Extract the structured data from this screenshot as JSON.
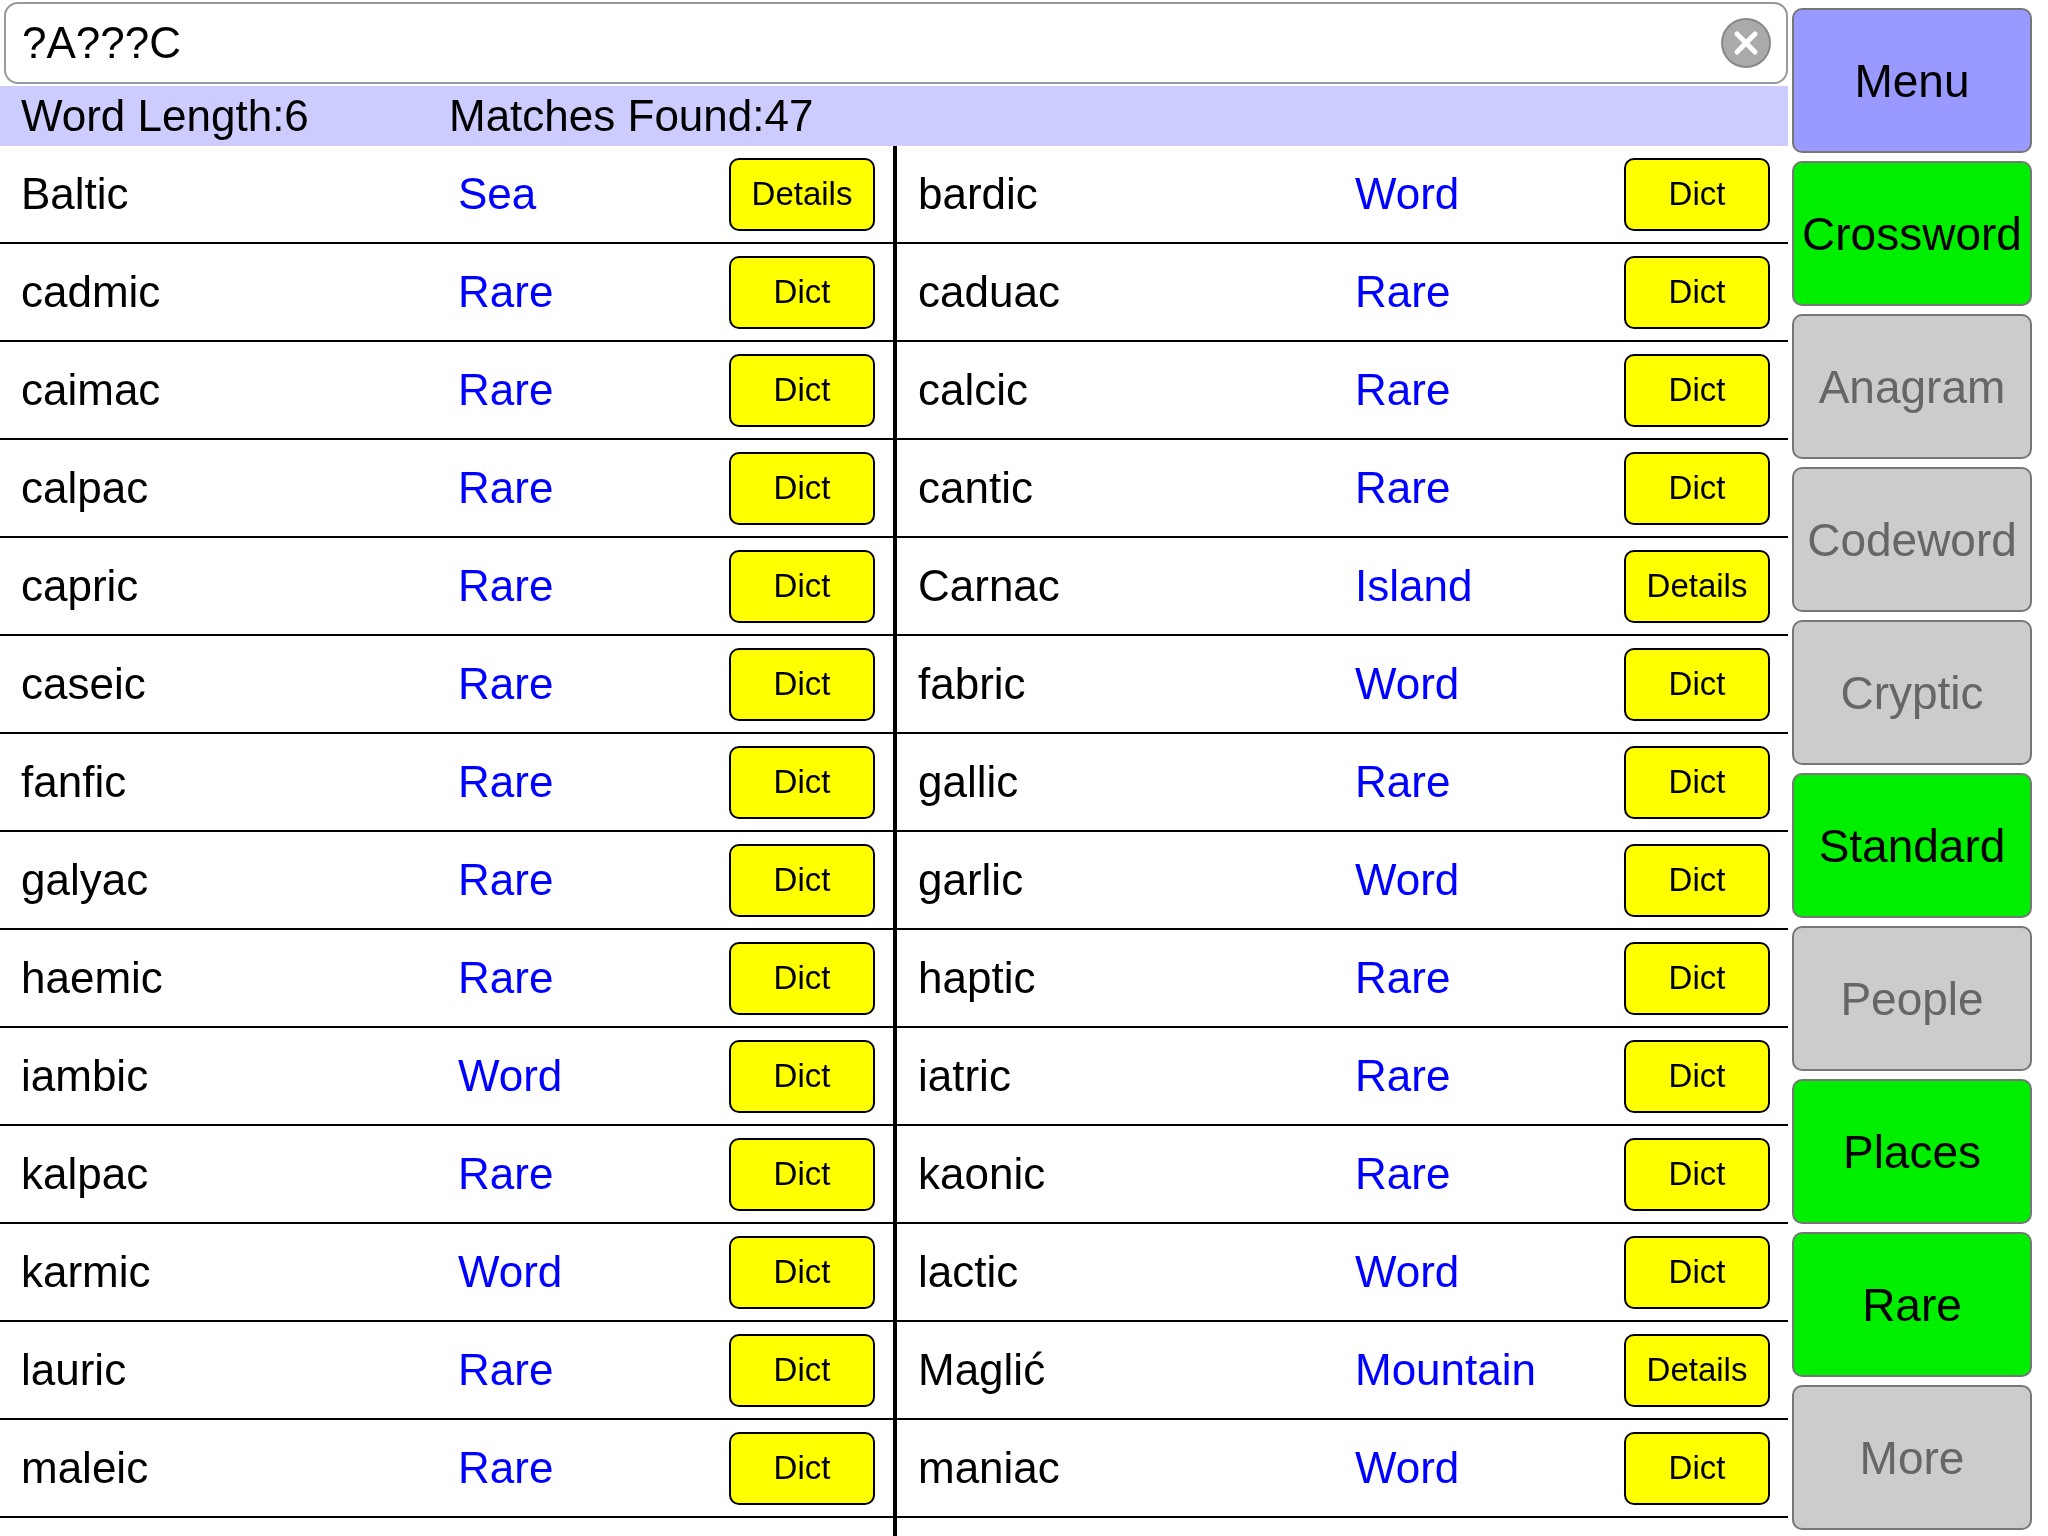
{
  "search": {
    "value": "?A???C"
  },
  "info": {
    "word_length": "Word Length:6",
    "matches": "Matches Found:47"
  },
  "rows": [
    {
      "left": {
        "word": "Baltic",
        "category": "Sea",
        "action": "Details"
      },
      "right": {
        "word": "bardic",
        "category": "Word",
        "action": "Dict"
      }
    },
    {
      "left": {
        "word": "cadmic",
        "category": "Rare",
        "action": "Dict"
      },
      "right": {
        "word": "caduac",
        "category": "Rare",
        "action": "Dict"
      }
    },
    {
      "left": {
        "word": "caimac",
        "category": "Rare",
        "action": "Dict"
      },
      "right": {
        "word": "calcic",
        "category": "Rare",
        "action": "Dict"
      }
    },
    {
      "left": {
        "word": "calpac",
        "category": "Rare",
        "action": "Dict"
      },
      "right": {
        "word": "cantic",
        "category": "Rare",
        "action": "Dict"
      }
    },
    {
      "left": {
        "word": "capric",
        "category": "Rare",
        "action": "Dict"
      },
      "right": {
        "word": "Carnac",
        "category": "Island",
        "action": "Details"
      }
    },
    {
      "left": {
        "word": "caseic",
        "category": "Rare",
        "action": "Dict"
      },
      "right": {
        "word": "fabric",
        "category": "Word",
        "action": "Dict"
      }
    },
    {
      "left": {
        "word": "fanfic",
        "category": "Rare",
        "action": "Dict"
      },
      "right": {
        "word": "gallic",
        "category": "Rare",
        "action": "Dict"
      }
    },
    {
      "left": {
        "word": "galyac",
        "category": "Rare",
        "action": "Dict"
      },
      "right": {
        "word": "garlic",
        "category": "Word",
        "action": "Dict"
      }
    },
    {
      "left": {
        "word": "haemic",
        "category": "Rare",
        "action": "Dict"
      },
      "right": {
        "word": "haptic",
        "category": "Rare",
        "action": "Dict"
      }
    },
    {
      "left": {
        "word": "iambic",
        "category": "Word",
        "action": "Dict"
      },
      "right": {
        "word": "iatric",
        "category": "Rare",
        "action": "Dict"
      }
    },
    {
      "left": {
        "word": "kalpac",
        "category": "Rare",
        "action": "Dict"
      },
      "right": {
        "word": "kaonic",
        "category": "Rare",
        "action": "Dict"
      }
    },
    {
      "left": {
        "word": "karmic",
        "category": "Word",
        "action": "Dict"
      },
      "right": {
        "word": "lactic",
        "category": "Word",
        "action": "Dict"
      }
    },
    {
      "left": {
        "word": "lauric",
        "category": "Rare",
        "action": "Dict"
      },
      "right": {
        "word": "Maglić",
        "category": "Mountain",
        "action": "Details"
      }
    },
    {
      "left": {
        "word": "maleic",
        "category": "Rare",
        "action": "Dict"
      },
      "right": {
        "word": "maniac",
        "category": "Word",
        "action": "Dict"
      }
    }
  ],
  "sidebar": [
    {
      "label": "Menu",
      "kind": "menu"
    },
    {
      "label": "Crossword",
      "kind": "toggle",
      "on": true
    },
    {
      "label": "Anagram",
      "kind": "toggle",
      "on": false
    },
    {
      "label": "Codeword",
      "kind": "toggle",
      "on": false
    },
    {
      "label": "Cryptic",
      "kind": "toggle",
      "on": false
    },
    {
      "label": "Standard",
      "kind": "toggle",
      "on": true
    },
    {
      "label": "People",
      "kind": "toggle",
      "on": false
    },
    {
      "label": "Places",
      "kind": "toggle",
      "on": true
    },
    {
      "label": "Rare",
      "kind": "toggle",
      "on": true
    },
    {
      "label": "More",
      "kind": "toggle",
      "on": false
    }
  ]
}
